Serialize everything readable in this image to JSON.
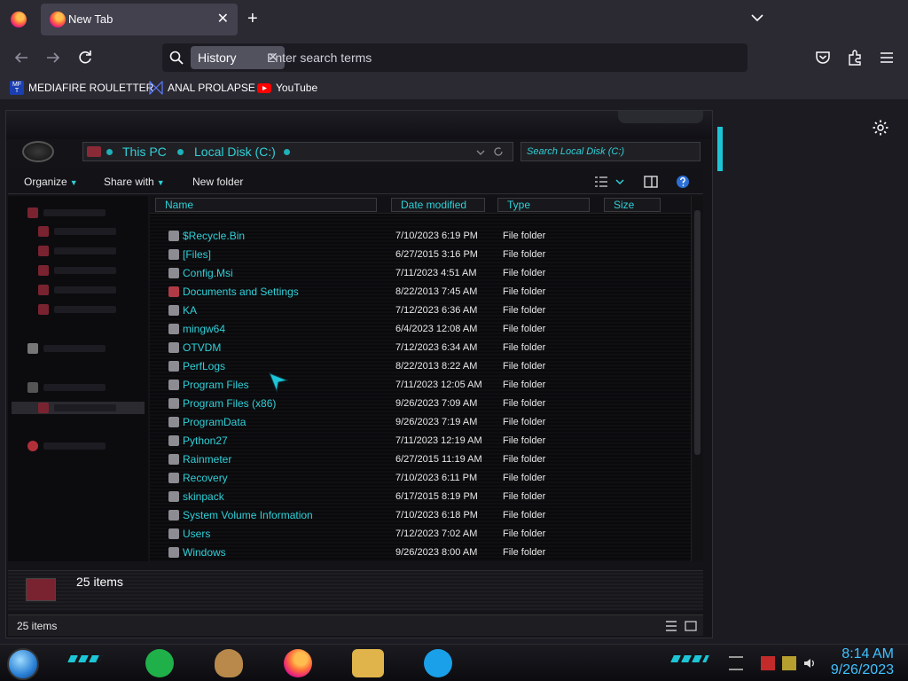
{
  "browser": {
    "tab_title": "New Tab",
    "close_tab": "✕",
    "new_tab": "+",
    "search_chip": "History",
    "chip_close": "✕",
    "search_placeholder": "Enter search terms",
    "bookmarks": [
      {
        "label": "MEDIAFIRE ROULETTER",
        "icon": "mediafire-icon",
        "icon_text": "MF T"
      },
      {
        "label": "ANAL PROLAPSE",
        "icon": "bookmark-glyph-icon"
      },
      {
        "label": "YouTube",
        "icon": "youtube-icon"
      }
    ],
    "colors": {
      "chrome": "#2b2a33",
      "urlbar": "#1c1b22",
      "chip": "#52525e",
      "text": "#fbfbfe"
    }
  },
  "explorer": {
    "address": [
      "This PC",
      "Local Disk (C:)"
    ],
    "search_placeholder": "Search Local Disk (C:)",
    "commands": {
      "organize": "Organize",
      "share_with": "Share with",
      "new_folder": "New folder"
    },
    "columns": {
      "name": "Name",
      "date": "Date modified",
      "type": "Type",
      "size": "Size"
    },
    "files": [
      {
        "name": "$Recycle.Bin",
        "date": "7/10/2023 6:19 PM",
        "type": "File folder"
      },
      {
        "name": "[Files]",
        "date": "6/27/2015 3:16 PM",
        "type": "File folder"
      },
      {
        "name": "Config.Msi",
        "date": "7/11/2023 4:51 AM",
        "type": "File folder"
      },
      {
        "name": "Documents and Settings",
        "date": "8/22/2013 7:45 AM",
        "type": "File folder"
      },
      {
        "name": "KA",
        "date": "7/12/2023 6:36 AM",
        "type": "File folder"
      },
      {
        "name": "mingw64",
        "date": "6/4/2023 12:08 AM",
        "type": "File folder"
      },
      {
        "name": "OTVDM",
        "date": "7/12/2023 6:34 AM",
        "type": "File folder"
      },
      {
        "name": "PerfLogs",
        "date": "8/22/2013 8:22 AM",
        "type": "File folder"
      },
      {
        "name": "Program Files",
        "date": "7/11/2023 12:05 AM",
        "type": "File folder"
      },
      {
        "name": "Program Files (x86)",
        "date": "9/26/2023 7:09 AM",
        "type": "File folder"
      },
      {
        "name": "ProgramData",
        "date": "9/26/2023 7:19 AM",
        "type": "File folder"
      },
      {
        "name": "Python27",
        "date": "7/11/2023 12:19 AM",
        "type": "File folder"
      },
      {
        "name": "Rainmeter",
        "date": "6/27/2015 11:19 AM",
        "type": "File folder"
      },
      {
        "name": "Recovery",
        "date": "7/10/2023 6:11 PM",
        "type": "File folder"
      },
      {
        "name": "skinpack",
        "date": "6/17/2015 8:19 PM",
        "type": "File folder"
      },
      {
        "name": "System Volume Information",
        "date": "7/10/2023 6:18 PM",
        "type": "File folder"
      },
      {
        "name": "Users",
        "date": "7/12/2023 7:02 AM",
        "type": "File folder"
      },
      {
        "name": "Windows",
        "date": "9/26/2023 8:00 AM",
        "type": "File folder"
      }
    ],
    "details_count": "25 items",
    "status_count": "25 items",
    "colors": {
      "accent": "#2fd0d8",
      "background": "#0a0a0c"
    }
  },
  "taskbar": {
    "time": "8:14 AM",
    "date": "9/26/2023",
    "apps": [
      "spotify-like-icon",
      "money-bag-icon",
      "firefox-icon",
      "file-explorer-icon",
      "skype-icon"
    ],
    "colors": {
      "clock": "#3fc2ff"
    }
  }
}
